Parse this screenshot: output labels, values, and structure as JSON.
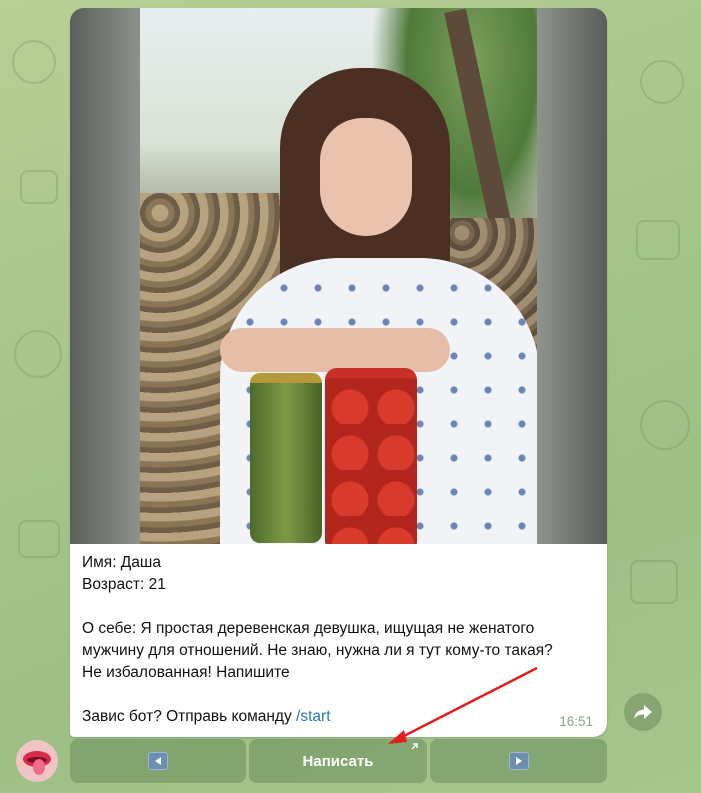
{
  "message": {
    "name_line": "Имя: Даша",
    "age_line": "Возраст: 21",
    "about_line1": "О себе: Я простая деревенская девушка, ищущая не женатого",
    "about_line2": "мужчину для отношений. Не знаю, нужна ли я тут кому-то такая?",
    "about_line3": "Не избалованная! Напишите",
    "hint_prefix": "Завис бот? Отправь команду ",
    "hint_command": "/start",
    "time": "16:51"
  },
  "keyboard": {
    "prev_icon": "left-arrow-icon",
    "write_label": "Написать",
    "next_icon": "right-arrow-icon"
  },
  "colors": {
    "background": "#a9c68c",
    "bubble": "#ffffff",
    "command_link": "#2a7ab0",
    "annotation_arrow": "#e02020"
  }
}
